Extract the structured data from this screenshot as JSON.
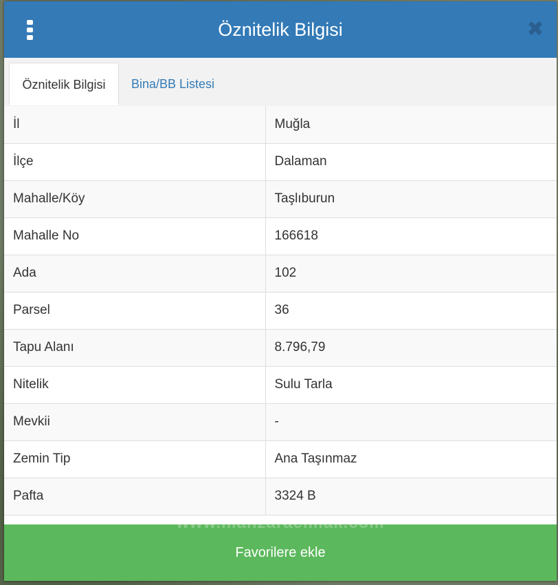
{
  "header": {
    "title": "Öznitelik Bilgisi",
    "menu_icon": "kebab-vertical-icon",
    "close_icon": "close-icon",
    "close_glyph": "✖"
  },
  "tabs": [
    {
      "label": "Öznitelik Bilgisi",
      "active": true
    },
    {
      "label": "Bina/BB Listesi",
      "active": false
    }
  ],
  "attributes": [
    {
      "key": "İl",
      "value": "Muğla"
    },
    {
      "key": "İlçe",
      "value": "Dalaman"
    },
    {
      "key": "Mahalle/Köy",
      "value": "Taşlıburun"
    },
    {
      "key": "Mahalle No",
      "value": "166618"
    },
    {
      "key": "Ada",
      "value": "102"
    },
    {
      "key": "Parsel",
      "value": "36"
    },
    {
      "key": "Tapu Alanı",
      "value": "8.796,79"
    },
    {
      "key": "Nitelik",
      "value": "Sulu Tarla"
    },
    {
      "key": "Mevkii",
      "value": "-"
    },
    {
      "key": "Zemin Tip",
      "value": "Ana Taşınmaz"
    },
    {
      "key": "Pafta",
      "value": "3324 B"
    }
  ],
  "footer": {
    "favorite_label": "Favorilere ekle",
    "watermark": "www.manzaraemlak.com"
  },
  "colors": {
    "header": "#337ab7",
    "button": "#5cb85c",
    "tab_link": "#337ab7"
  }
}
